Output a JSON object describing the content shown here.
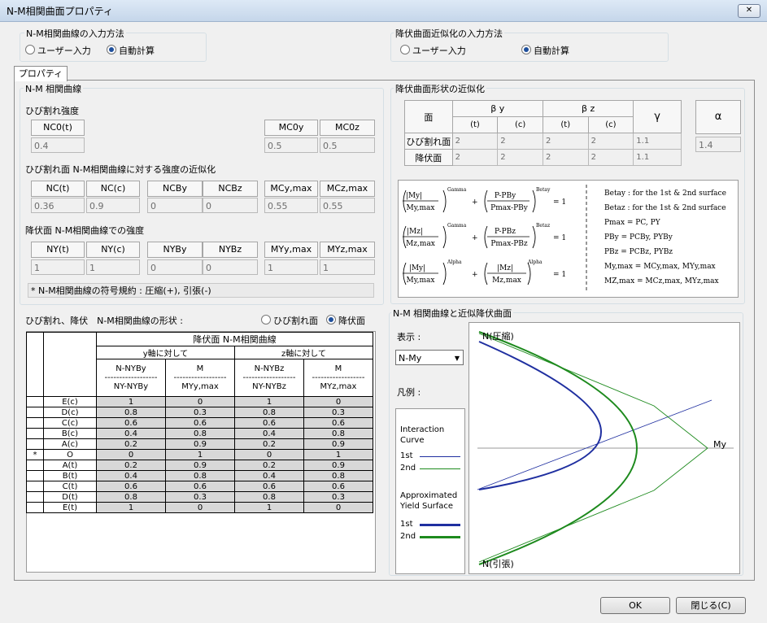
{
  "window": {
    "title": "N-M相関曲面プロパティ",
    "close": "✕"
  },
  "input_method": {
    "label": "N-M相関曲線の入力方法",
    "opt_user": "ユーザー入力",
    "opt_auto": "自動計算",
    "selected": "auto"
  },
  "yield_method": {
    "label": "降伏曲面近似化の入力方法",
    "opt_user": "ユーザー入力",
    "opt_auto": "自動計算",
    "selected": "auto"
  },
  "tab": {
    "label": "プロパティ"
  },
  "nm_curve": {
    "title": "N-M 相関曲線",
    "crack": {
      "label": "ひび割れ強度",
      "headers": [
        "NC0(t)",
        "MC0y",
        "MC0z"
      ],
      "values": [
        "0.4",
        "0.5",
        "0.5"
      ]
    },
    "crack_approx": {
      "label": "ひび割れ面 N-M相関曲線に対する強度の近似化",
      "headers": [
        "NC(t)",
        "NC(c)",
        "NCBy",
        "NCBz",
        "MCy,max",
        "MCz,max"
      ],
      "values": [
        "0.36",
        "0.9",
        "0",
        "0",
        "0.55",
        "0.55"
      ]
    },
    "yield": {
      "label": "降伏面 N-M相関曲線での強度",
      "headers": [
        "NY(t)",
        "NY(c)",
        "NYBy",
        "NYBz",
        "MYy,max",
        "MYz,max"
      ],
      "values": [
        "1",
        "1",
        "0",
        "0",
        "1",
        "1"
      ]
    },
    "sign_note": "* N-M相関曲線の符号規約 : 圧縮(+), 引張(-)",
    "shape_label": "ひび割れ、降伏　N-M相関曲線の形状 :",
    "shape_opt_crack": "ひび割れ面",
    "shape_opt_yield": "降伏面",
    "shape_selected": "yield",
    "table": {
      "title": "降伏面 N-M相関曲線",
      "y_axis": "y軸に対して",
      "z_axis": "z軸に対して",
      "col_n_top": "N-NYBy",
      "col_n_bot": "NY-NYBy",
      "col_m_top": "M",
      "col_m_bot": "MYy,max",
      "col_nz_top": "N-NYBz",
      "col_nz_bot": "NY-NYBz",
      "col_mz_top": "M",
      "col_mz_bot": "MYz,max",
      "divider": "------------------",
      "rows": [
        {
          "label": "E(c)",
          "v": [
            "1",
            "0",
            "1",
            "0"
          ]
        },
        {
          "label": "D(c)",
          "v": [
            "0.8",
            "0.3",
            "0.8",
            "0.3"
          ]
        },
        {
          "label": "C(c)",
          "v": [
            "0.6",
            "0.6",
            "0.6",
            "0.6"
          ]
        },
        {
          "label": "B(c)",
          "v": [
            "0.4",
            "0.8",
            "0.4",
            "0.8"
          ]
        },
        {
          "label": "A(c)",
          "v": [
            "0.2",
            "0.9",
            "0.2",
            "0.9"
          ]
        },
        {
          "label": "O",
          "v": [
            "0",
            "1",
            "0",
            "1"
          ]
        },
        {
          "label": "A(t)",
          "v": [
            "0.2",
            "0.9",
            "0.2",
            "0.9"
          ]
        },
        {
          "label": "B(t)",
          "v": [
            "0.4",
            "0.8",
            "0.4",
            "0.8"
          ]
        },
        {
          "label": "C(t)",
          "v": [
            "0.6",
            "0.6",
            "0.6",
            "0.6"
          ]
        },
        {
          "label": "D(t)",
          "v": [
            "0.8",
            "0.3",
            "0.8",
            "0.3"
          ]
        },
        {
          "label": "E(t)",
          "v": [
            "1",
            "0",
            "1",
            "0"
          ]
        }
      ]
    }
  },
  "yield_shape": {
    "title": "降伏曲面形状の近似化",
    "col_face": "面",
    "col_by": "β y",
    "col_bz": "β z",
    "col_gamma": "γ",
    "col_alpha": "α",
    "sub_t": "(t)",
    "sub_c": "(c)",
    "row_crack": "ひび割れ面",
    "row_yield": "降伏面",
    "crack_vals": [
      "2",
      "2",
      "2",
      "2",
      "1.1"
    ],
    "yield_vals": [
      "2",
      "2",
      "2",
      "2",
      "1.1"
    ],
    "alpha": "1.4"
  },
  "formula": {
    "f1_num_a": "|My|",
    "f1_den_a": "My,max",
    "f1_exp_a": "Gamma",
    "f1_num_b": "P-PBy",
    "f1_den_b": "Pmax-PBy",
    "f1_exp_b": "Betay",
    "f2_num_a": "|Mz|",
    "f2_den_a": "Mz,max",
    "f2_exp_a": "Gamma",
    "f2_num_b": "P-PBz",
    "f2_den_b": "Pmax-PBz",
    "f2_exp_b": "Betaz",
    "f3_num_a": "|My|",
    "f3_den_a": "My,max",
    "f3_exp_a": "Alpha",
    "f3_num_b": "|Mz|",
    "f3_den_b": "Mz,max",
    "f3_exp_b": "Alpha",
    "plus": "+",
    "eq": "= 1",
    "notes": [
      "Betay : for the 1st & 2nd surface",
      "Betaz : for the 1st & 2nd surface",
      "Pmax = PC, PY",
      "PBy = PCBy, PYBy",
      "PBz = PCBz, PYBz",
      "My,max = MCy,max, MYy,max",
      "MZ,max = MCz,max, MYz,max"
    ]
  },
  "graph": {
    "title": "N-M 相関曲線と近似降伏曲面",
    "display_label": "表示 :",
    "display_value": "N-My",
    "legend_label": "凡例 :",
    "interaction_label": "Interaction Curve",
    "approx_label": "Approximated Yield Surface",
    "first": "1st",
    "second": "2nd",
    "top_label": "N(圧縮)",
    "bottom_label": "N(引張)",
    "right_label": "My",
    "colors": {
      "first": "#1f2fa0",
      "second": "#1d8a1d"
    }
  },
  "buttons": {
    "ok": "OK",
    "close": "閉じる(C)"
  }
}
